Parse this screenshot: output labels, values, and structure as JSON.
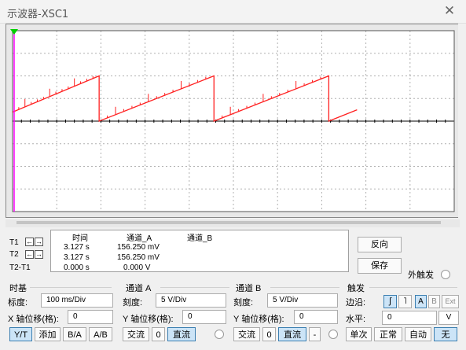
{
  "window": {
    "title": "示波器-XSC1",
    "close_glyph": "✕"
  },
  "screen": {
    "background": "#000000",
    "grid_color": "#b0b0b0",
    "trace_color": "#ff2020",
    "cursor_t1_color": "#ff00ff",
    "cursor_t2_color": "#00d000"
  },
  "chart_data": {
    "type": "line",
    "title": "",
    "xlabel": "",
    "ylabel": "",
    "x_divisions": 10,
    "y_divisions": 8,
    "series": [
      {
        "values_description": "channel A sawtooth",
        "points": [
          [
            0.0,
            0.4
          ],
          [
            1.96,
            2.0
          ],
          [
            1.96,
            0.0
          ],
          [
            4.56,
            2.0
          ],
          [
            4.56,
            0.0
          ],
          [
            7.16,
            2.0
          ],
          [
            7.16,
            0.0
          ],
          [
            7.8,
            0.5
          ]
        ]
      }
    ]
  },
  "cursors": {
    "t1_label": "T1",
    "t2_label": "T2",
    "diff_label": "T2-T1",
    "left_arrow": "←",
    "right_arrow": "→",
    "headers": {
      "time": "时间",
      "ch_a": "通道_A",
      "ch_b": "通道_B"
    },
    "rows": [
      {
        "time": "3.127 s",
        "ch_a": "156.250 mV",
        "ch_b": ""
      },
      {
        "time": "3.127 s",
        "ch_a": "156.250 mV",
        "ch_b": ""
      },
      {
        "time": "0.000 s",
        "ch_a": "0.000 V",
        "ch_b": ""
      }
    ]
  },
  "side_buttons": {
    "reverse": "反向",
    "save": "保存",
    "ext_trigger": "外触发"
  },
  "timebase": {
    "title": "时基",
    "scale_label": "标度:",
    "scale_value": "100 ms/Div",
    "xpos_label": "X 轴位移(格):",
    "xpos_value": "0",
    "modes": [
      "Y/T",
      "添加",
      "B/A",
      "A/B"
    ]
  },
  "channel_a": {
    "title": "通道 A",
    "scale_label": "刻度:",
    "scale_value": "5  V/Div",
    "ypos_label": "Y 轴位移(格):",
    "ypos_value": "0",
    "coupling": [
      "交流",
      "0",
      "直流"
    ]
  },
  "channel_b": {
    "title": "通道 B",
    "scale_label": "刻度:",
    "scale_value": "5  V/Div",
    "ypos_label": "Y 轴位移(格):",
    "ypos_value": "0",
    "coupling": [
      "交流",
      "0",
      "直流",
      "-"
    ]
  },
  "trigger": {
    "title": "触发",
    "edge_label": "边沿:",
    "edge_buttons": [
      "ʃ",
      "˥",
      "A",
      "B",
      "Ext"
    ],
    "level_label": "水平:",
    "level_value": "0",
    "level_unit": "V",
    "modes": [
      "单次",
      "正常",
      "自动",
      "无"
    ]
  }
}
